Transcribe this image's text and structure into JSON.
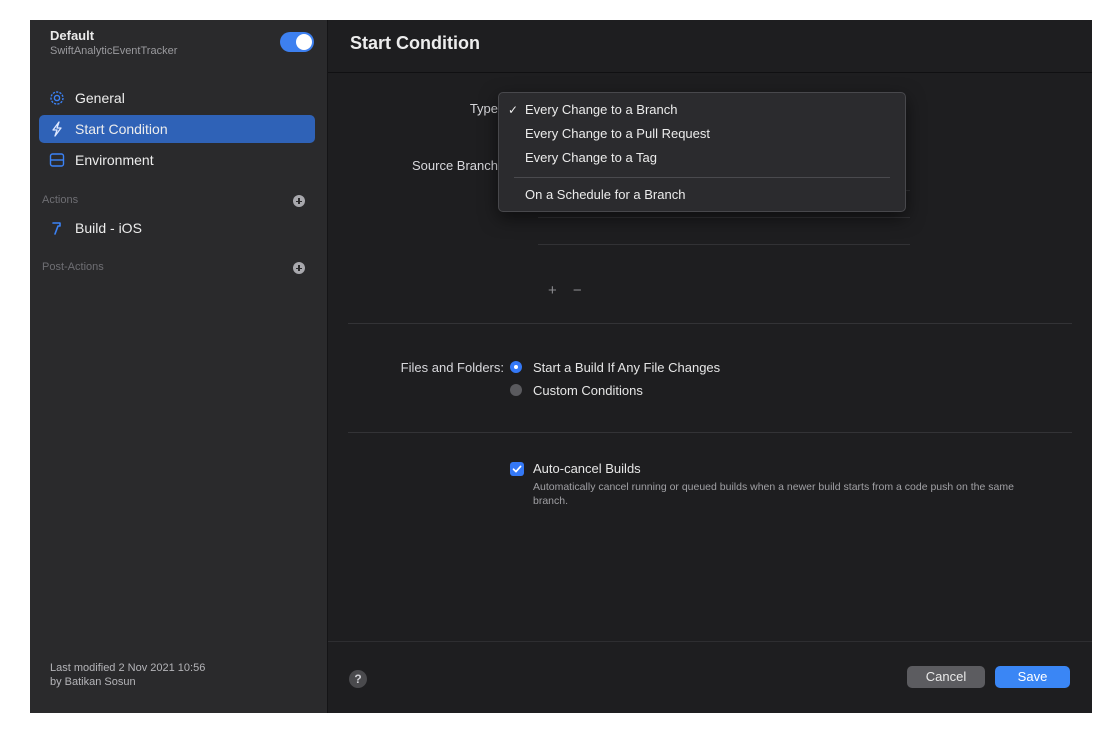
{
  "sidebar": {
    "workflow_title": "Default",
    "workflow_subtitle": "SwiftAnalyticEventTracker",
    "items": [
      {
        "label": "General",
        "icon": "gear-icon",
        "selected": false
      },
      {
        "label": "Start Condition",
        "icon": "bolt-icon",
        "selected": true
      },
      {
        "label": "Environment",
        "icon": "server-icon",
        "selected": false
      }
    ],
    "actions_header": "Actions",
    "actions": [
      {
        "label": "Build - iOS",
        "icon": "hammer-icon"
      }
    ],
    "post_actions_header": "Post-Actions",
    "modified_line1": "Last modified 2 Nov 2021 10:56",
    "modified_line2": "by Batikan Sosun"
  },
  "main": {
    "title": "Start Condition",
    "type_label": "Type",
    "source_branch_label": "Source Branch",
    "files_label": "Files and Folders:",
    "files_options": [
      {
        "label": "Start a Build If Any File Changes",
        "selected": true
      },
      {
        "label": "Custom Conditions",
        "selected": false
      }
    ],
    "auto_cancel": {
      "label": "Auto-cancel Builds",
      "checked": true,
      "description": "Automatically cancel running or queued builds when a newer build starts from a code push on the same branch."
    },
    "plus_minus": "+ −"
  },
  "dropdown": {
    "items": [
      {
        "label": "Every Change to a Branch",
        "checked": true
      },
      {
        "label": "Every Change to a Pull Request",
        "checked": false
      },
      {
        "label": "Every Change to a Tag",
        "checked": false
      },
      {
        "label": "On a Schedule for a Branch",
        "checked": false
      }
    ],
    "check_glyph": "✓"
  },
  "footer": {
    "help": "?",
    "cancel": "Cancel",
    "save": "Save"
  },
  "colors": {
    "accent": "#3478f6",
    "selection": "#2f62b7"
  }
}
